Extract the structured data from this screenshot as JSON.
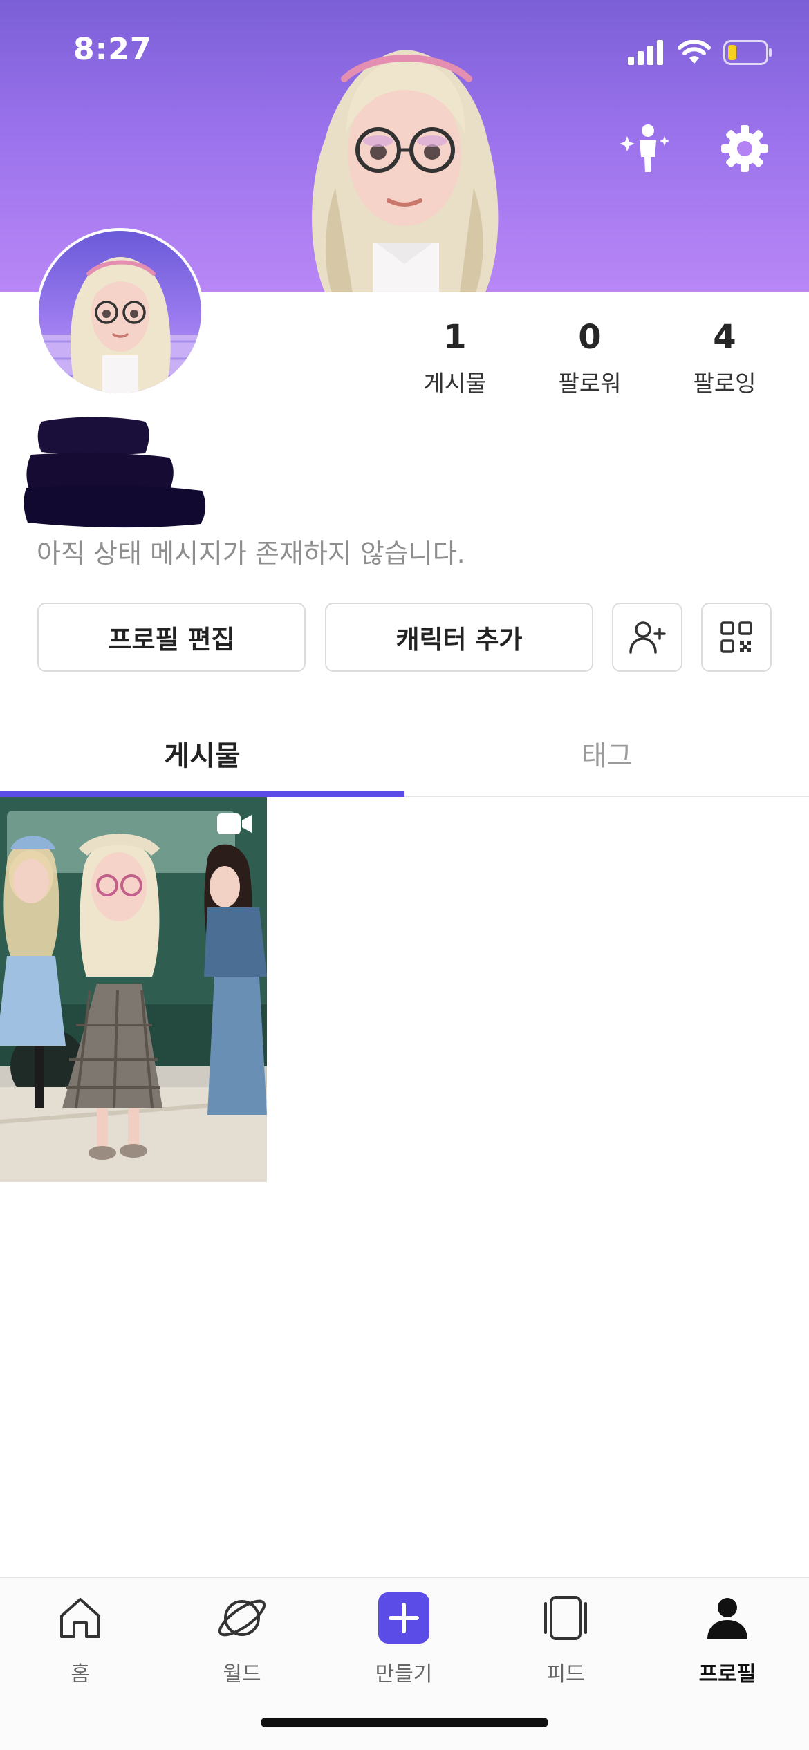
{
  "status_bar": {
    "time": "8:27"
  },
  "profile": {
    "stats": [
      {
        "value": "1",
        "label": "게시물"
      },
      {
        "value": "0",
        "label": "팔로워"
      },
      {
        "value": "4",
        "label": "팔로잉"
      }
    ],
    "status_message": "아직 상태 메시지가 존재하지 않습니다."
  },
  "actions": {
    "edit_profile": "프로필 편집",
    "add_character": "캐릭터 추가"
  },
  "tabs": [
    {
      "label": "게시물",
      "active": true
    },
    {
      "label": "태그",
      "active": false
    }
  ],
  "posts": [
    {
      "type": "video"
    }
  ],
  "bottom_nav": [
    {
      "label": "홈",
      "icon": "home-icon"
    },
    {
      "label": "월드",
      "icon": "planet-icon"
    },
    {
      "label": "만들기",
      "icon": "plus-icon"
    },
    {
      "label": "피드",
      "icon": "feed-icon"
    },
    {
      "label": "프로필",
      "icon": "person-icon",
      "active": true
    }
  ],
  "colors": {
    "accent": "#5b4ce8",
    "banner_top": "#7b5fd6",
    "banner_bottom": "#b987f6"
  }
}
